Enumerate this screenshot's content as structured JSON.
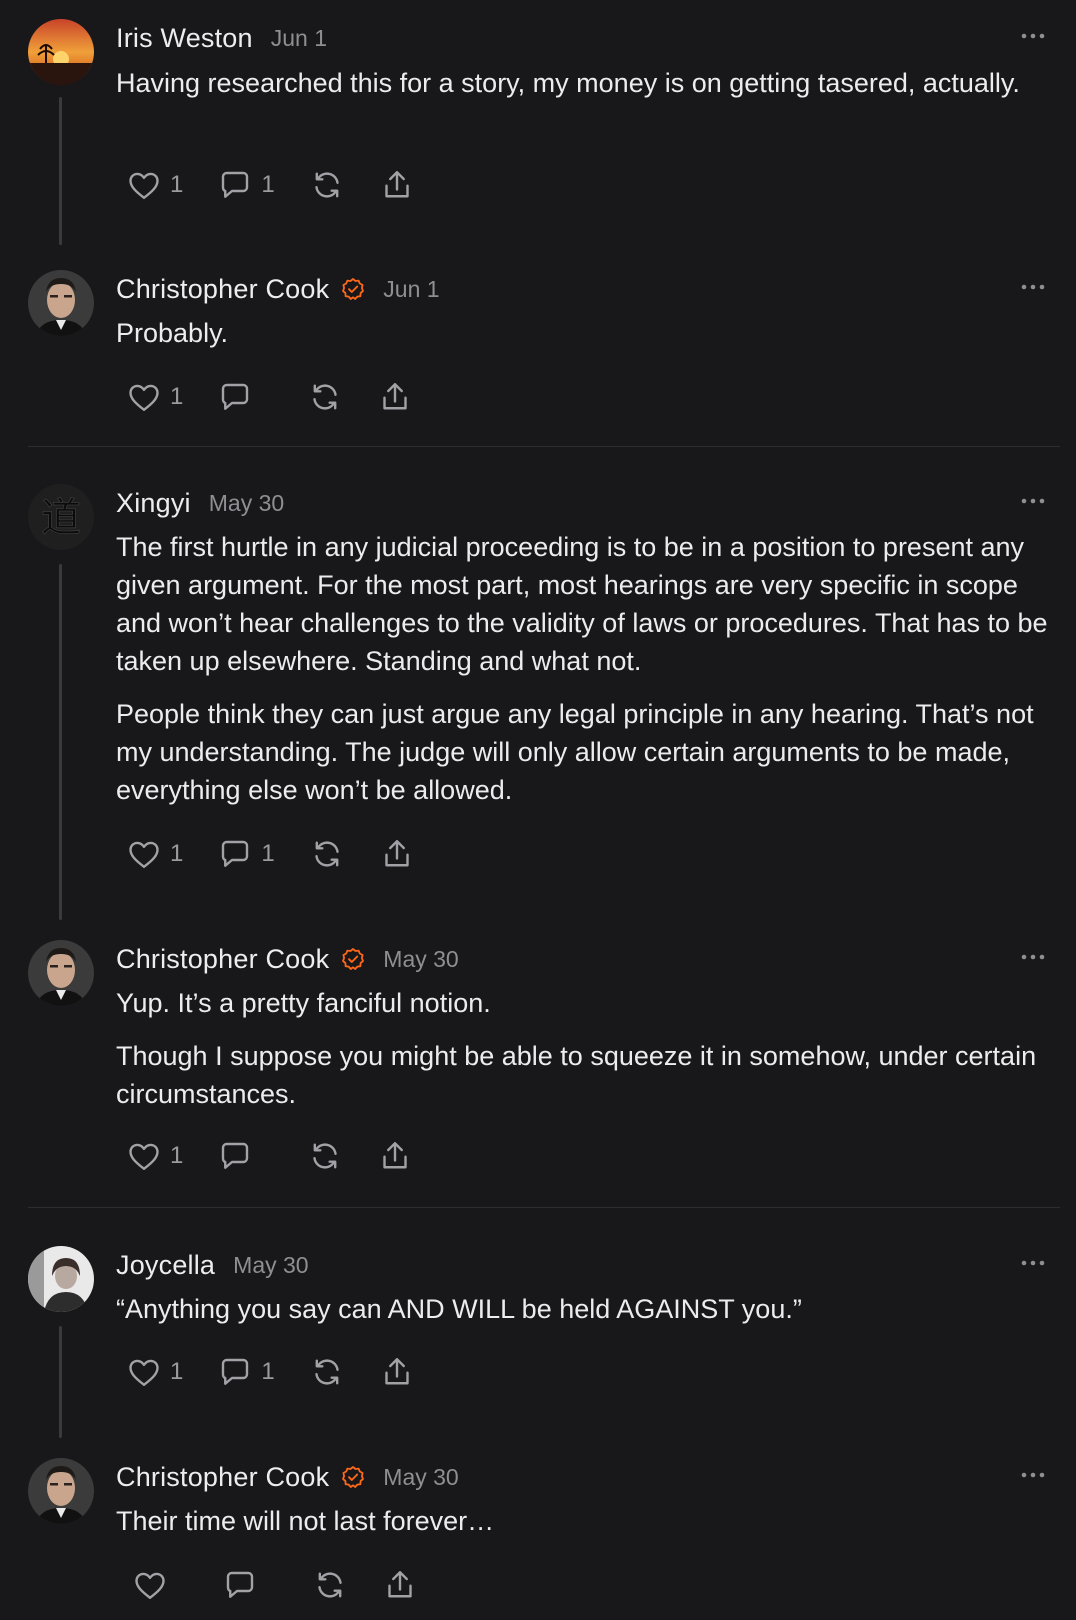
{
  "comments": [
    {
      "author": "Iris Weston",
      "date": "Jun 1",
      "verified": false,
      "paragraphs": [
        "Having researched this for a story, my money is on getting tasered, actually."
      ],
      "likes": "1",
      "replies": "1"
    },
    {
      "author": "Christopher Cook",
      "date": "Jun 1",
      "verified": true,
      "paragraphs": [
        "Probably."
      ],
      "likes": "1",
      "replies": ""
    },
    {
      "author": "Xingyi",
      "date": "May 30",
      "verified": false,
      "paragraphs": [
        "The first hurtle in any judicial proceeding is to be in a position to present any given argument. For the most part, most hearings are very specific in scope and won’t hear challenges to the validity of laws or procedures. That has to be taken up elsewhere. Standing and what not.",
        "People think they can just argue any legal principle in any hearing. That’s not my understanding. The judge will only allow certain arguments to be made, everything else won’t be allowed."
      ],
      "likes": "1",
      "replies": "1"
    },
    {
      "author": "Christopher Cook",
      "date": "May 30",
      "verified": true,
      "paragraphs": [
        "Yup. It’s a pretty fanciful notion.",
        "Though I suppose you might be able to squeeze it in somehow, under certain circumstances."
      ],
      "likes": "1",
      "replies": ""
    },
    {
      "author": "Joycella",
      "date": "May 30",
      "verified": false,
      "paragraphs": [
        "“Anything you say can AND WILL be held AGAINST you.”"
      ],
      "likes": "1",
      "replies": "1"
    },
    {
      "author": "Christopher Cook",
      "date": "May 30",
      "verified": true,
      "paragraphs": [
        "Their time will not last forever…"
      ],
      "likes": "",
      "replies": ""
    }
  ],
  "icons": {
    "like": "heart-icon",
    "reply": "comment-icon",
    "restack": "restack-icon",
    "share": "share-icon",
    "more": "more-options-icon",
    "verified": "verified-badge-icon"
  },
  "colors": {
    "background": "#18181b",
    "accent": "#ff6719",
    "muted": "#8e8e93"
  }
}
